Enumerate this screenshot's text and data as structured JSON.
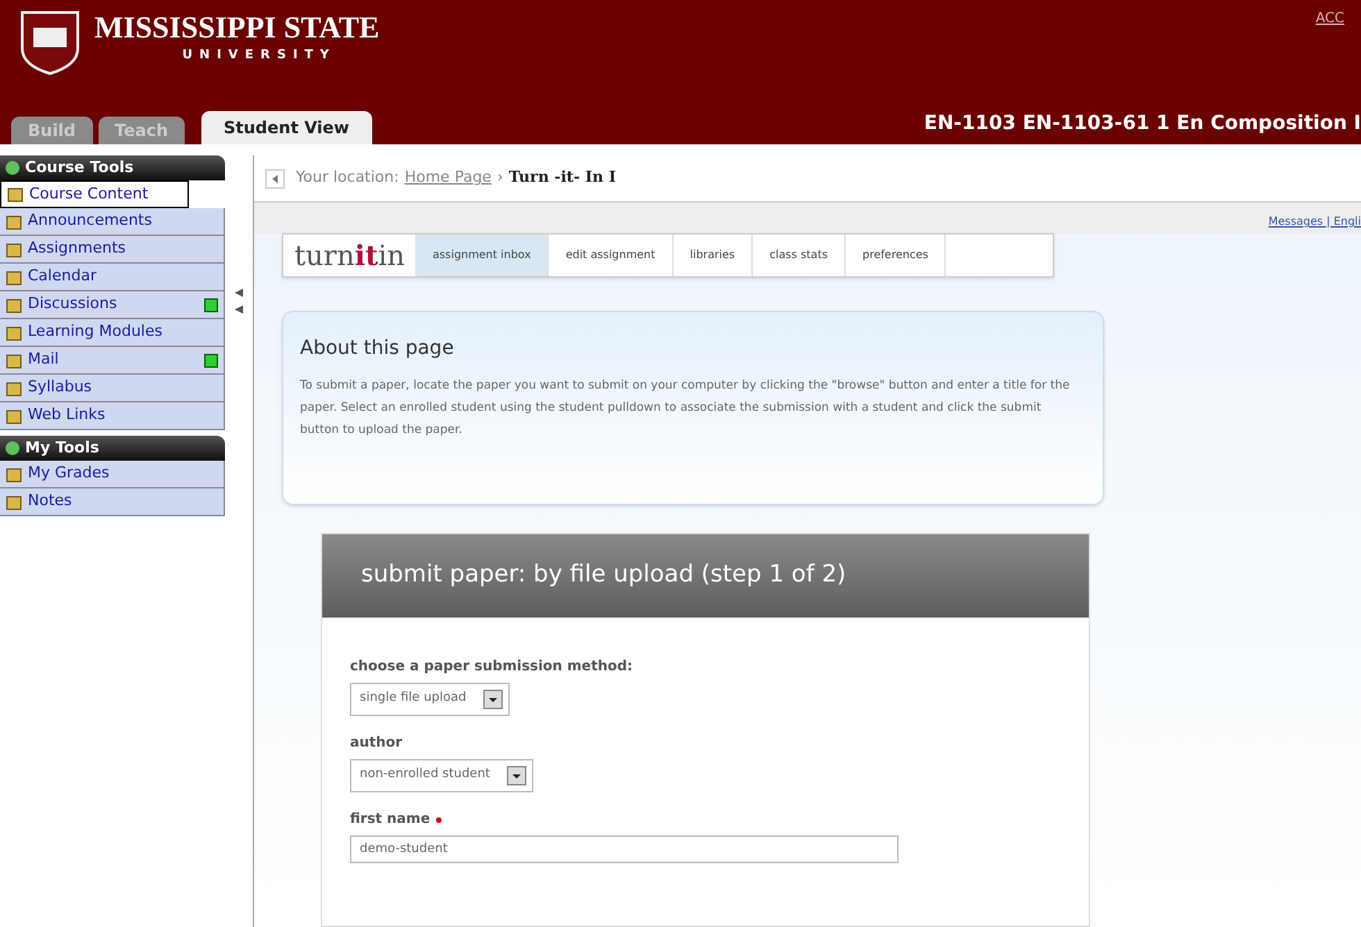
{
  "header": {
    "university": "MISSISSIPPI STATE",
    "subtitle": "UNIVERSITY",
    "top_link": "ACC",
    "course_title": "EN-1103 EN-1103-61 1 En Composition I"
  },
  "tabs": [
    {
      "label": "Build",
      "selected": false
    },
    {
      "label": "Teach",
      "selected": false
    },
    {
      "label": "Student View",
      "selected": true
    }
  ],
  "sidebar": [
    {
      "title": "Course Tools",
      "items": [
        {
          "label": "Course Content",
          "selected": true,
          "new": false
        },
        {
          "label": "Announcements",
          "selected": false,
          "new": false
        },
        {
          "label": "Assignments",
          "selected": false,
          "new": false
        },
        {
          "label": "Calendar",
          "selected": false,
          "new": false
        },
        {
          "label": "Discussions",
          "selected": false,
          "new": true
        },
        {
          "label": "Learning Modules",
          "selected": false,
          "new": false
        },
        {
          "label": "Mail",
          "selected": false,
          "new": true
        },
        {
          "label": "Syllabus",
          "selected": false,
          "new": false
        },
        {
          "label": "Web Links",
          "selected": false,
          "new": false
        }
      ]
    },
    {
      "title": "My Tools",
      "items": [
        {
          "label": "My Grades",
          "selected": false,
          "new": false
        },
        {
          "label": "Notes",
          "selected": false,
          "new": false
        }
      ]
    }
  ],
  "breadcrumb": {
    "label": "Your location:",
    "home": "Home Page",
    "separator": "›",
    "current": "Turn -it- In I"
  },
  "utility_links": "Messages | Engli",
  "turnitin": {
    "logo": [
      "turn",
      "it",
      "in"
    ],
    "tabs": [
      {
        "label": "assignment inbox",
        "selected": true
      },
      {
        "label": "edit assignment",
        "selected": false
      },
      {
        "label": "libraries",
        "selected": false
      },
      {
        "label": "class stats",
        "selected": false
      },
      {
        "label": "preferences",
        "selected": false
      }
    ]
  },
  "about": {
    "title": "About this page",
    "text": "To submit a paper, locate the paper you want to submit on your computer by clicking the \"browse\" button and enter a title for the paper. Select an enrolled student using the student pulldown to associate the submission with a student and click the submit button to upload the paper."
  },
  "submit": {
    "title": "submit paper: by file upload (step 1 of 2)",
    "fields": [
      {
        "kind": "select",
        "label": "choose a paper submission method:",
        "value": "single file upload",
        "required": false
      },
      {
        "kind": "select",
        "label": "author",
        "value": "non-enrolled student",
        "required": false
      },
      {
        "kind": "text",
        "label": "first name",
        "value": "demo-student",
        "required": true
      }
    ]
  }
}
